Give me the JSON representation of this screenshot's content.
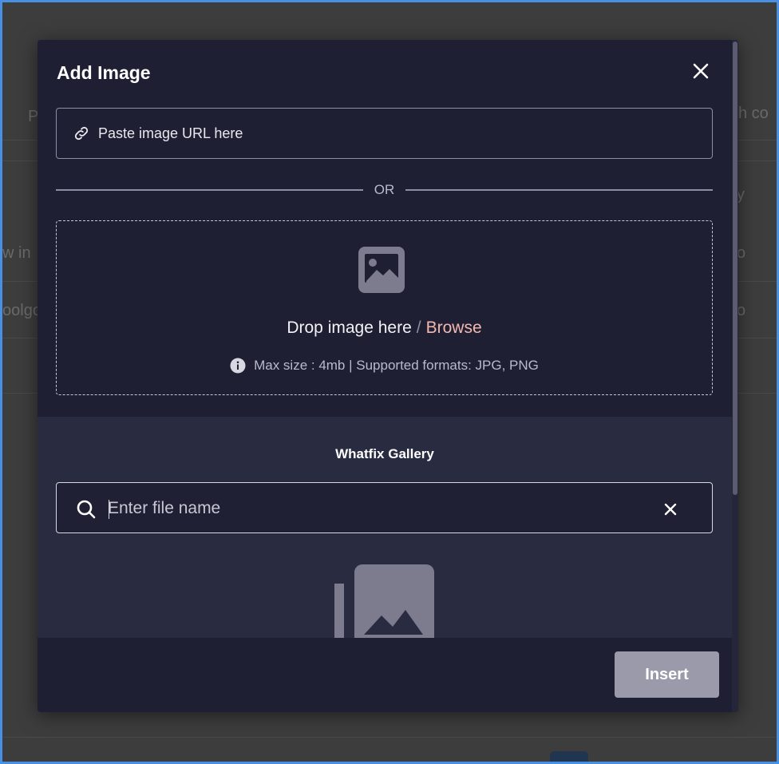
{
  "background": {
    "fragments": [
      "P",
      "ch co",
      "y",
      "w in",
      "o",
      "oolgo",
      "o"
    ]
  },
  "modal": {
    "title": "Add Image",
    "url_placeholder": "Paste image URL here",
    "or_label": "OR",
    "drop": {
      "text": "Drop image here",
      "separator": "/",
      "browse": "Browse",
      "hint": "Max size : 4mb | Supported formats: JPG, PNG"
    },
    "gallery": {
      "title": "Whatfix Gallery",
      "search_placeholder": "Enter file name"
    },
    "footer": {
      "insert_label": "Insert"
    }
  },
  "colors": {
    "modal_bg": "#1e1f32",
    "gallery_bg": "#292b40",
    "browse_link": "#f2b8b0",
    "insert_disabled": "#9a9aab"
  },
  "icons": [
    "close-icon",
    "link-icon",
    "image-icon",
    "info-icon",
    "search-icon",
    "clear-icon",
    "empty-gallery-icon"
  ]
}
